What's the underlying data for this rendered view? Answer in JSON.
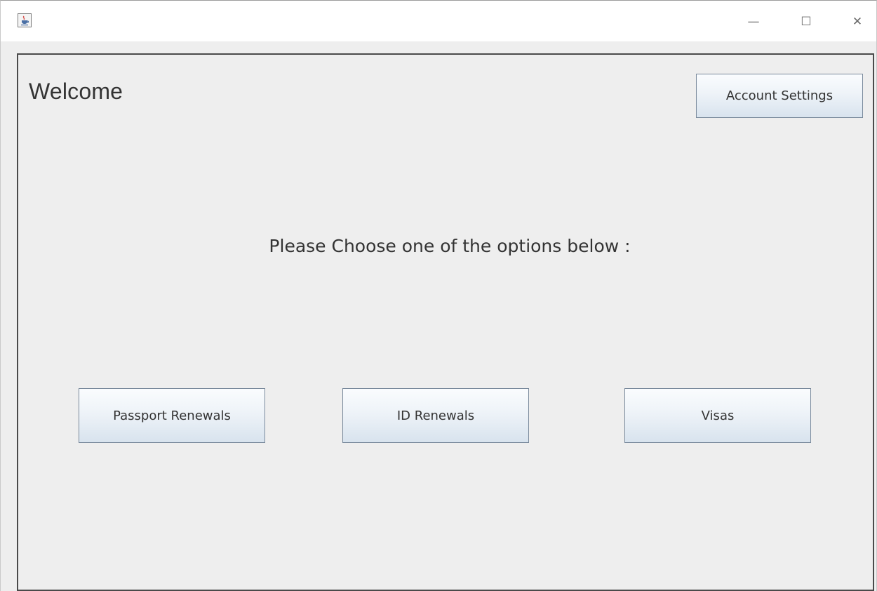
{
  "window": {
    "title": "",
    "icon": "java-coffee-cup-icon",
    "controls": {
      "minimize_glyph": "—",
      "maximize_glyph": "☐",
      "close_glyph": "✕"
    }
  },
  "main": {
    "heading": "Welcome",
    "prompt": "Please Choose one of the options below :",
    "account_settings_label": "Account Settings",
    "options": [
      {
        "label": "Passport Renewals"
      },
      {
        "label": "ID Renewals"
      },
      {
        "label": "Visas"
      }
    ]
  },
  "colors": {
    "panel_background": "#eeeeee",
    "button_border": "#7a8a9c",
    "button_gradient_top": "#fafcfe",
    "button_gradient_bottom": "#d8e3ee",
    "text": "#333333"
  }
}
